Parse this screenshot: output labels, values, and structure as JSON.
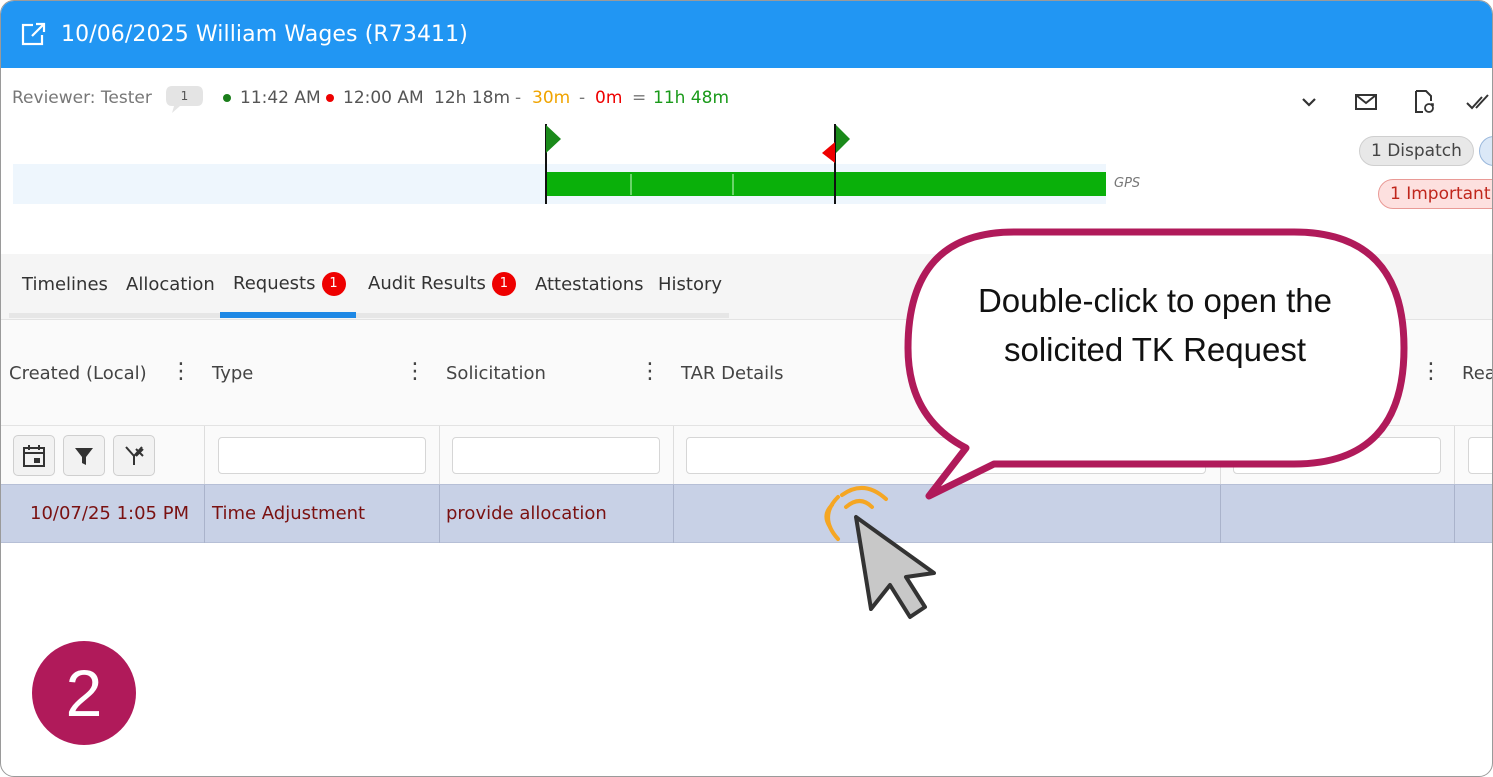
{
  "header": {
    "title": "10/06/2025 William Wages (R73411)",
    "icon": "open-external-icon",
    "background": "#2196f3"
  },
  "summary": {
    "reviewer": "Reviewer: Tester",
    "comment_count": "1",
    "start_time": "11:42 AM",
    "end_time": "12:00 AM",
    "duration": "12h 18m",
    "minus_1": "-",
    "deduction_1": "30m",
    "minus_2": "-",
    "deduction_2": "0m",
    "equals": "=",
    "total": "11h 48m"
  },
  "toolbar_icons": [
    "chevron-down-icon",
    "mail-icon",
    "document-refresh-icon",
    "double-check-icon"
  ],
  "pills": {
    "dispatch": "1 Dispatch",
    "important": "1 Important ."
  },
  "timeline": {
    "source_label": "GPS",
    "bar_color": "#0ab00a"
  },
  "tabs": [
    {
      "label": "Timelines"
    },
    {
      "label": "Allocation"
    },
    {
      "label": "Requests",
      "badge": "1",
      "active": true
    },
    {
      "label": "Audit Results",
      "badge": "1"
    },
    {
      "label": "Attestations"
    },
    {
      "label": "History"
    }
  ],
  "grid": {
    "columns": [
      "Created (Local)",
      "Type",
      "Solicitation",
      "TAR Details",
      "Rea"
    ],
    "rows": [
      {
        "created": "10/07/25 1:05 PM",
        "type": "Time Adjustment",
        "solicitation": "provide allocation",
        "tar_details": ""
      }
    ]
  },
  "callout": {
    "text": "Double-click to open the solicited TK Request",
    "border_color": "#b01a5a"
  },
  "step_number": "2",
  "colors": {
    "accent": "#2196f3",
    "selected_row": "#c8d1e6",
    "badge": "#e00000",
    "step_marker": "#b01a5a"
  }
}
